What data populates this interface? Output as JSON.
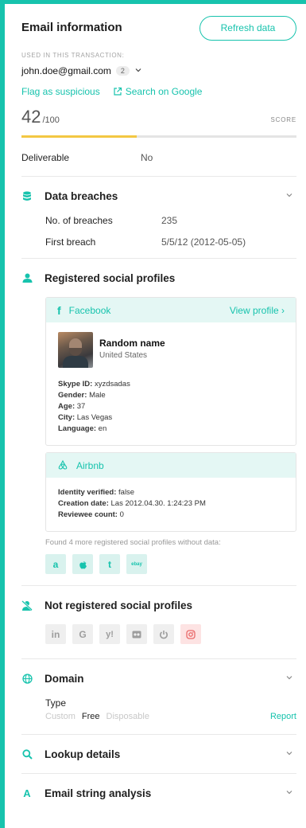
{
  "header": {
    "title": "Email information",
    "refresh_label": "Refresh data"
  },
  "email": {
    "used_label": "USED IN THIS TRANSACTION:",
    "address": "john.doe@gmail.com",
    "count": "2",
    "flag_link": "Flag as suspicious",
    "search_link": "Search on Google"
  },
  "score": {
    "value": "42",
    "total": "/100",
    "label": "SCORE",
    "fraction": 0.42,
    "bar_color": "#f3c743"
  },
  "deliverable": {
    "label": "Deliverable",
    "value": "No"
  },
  "breaches": {
    "title": "Data breaches",
    "rows": [
      {
        "label": "No. of breaches",
        "value": "235"
      },
      {
        "label": "First breach",
        "value": "5/5/12 (2012-05-05)"
      }
    ]
  },
  "social": {
    "title": "Registered social profiles",
    "facebook": {
      "name": "Facebook",
      "view": "View profile",
      "profile_name": "Random name",
      "profile_location": "United States",
      "fields": [
        {
          "k": "Skype ID:",
          "v": "xyzdsadas"
        },
        {
          "k": "Gender:",
          "v": "Male"
        },
        {
          "k": "Age:",
          "v": "37"
        },
        {
          "k": "City:",
          "v": "Las Vegas"
        },
        {
          "k": "Language:",
          "v": "en"
        }
      ]
    },
    "airbnb": {
      "name": "Airbnb",
      "fields": [
        {
          "k": "Identity verified:",
          "v": "false"
        },
        {
          "k": "Creation date:",
          "v": "Las 2012.04.30. 1:24:23 PM"
        },
        {
          "k": "Reviewee count:",
          "v": "0"
        }
      ]
    },
    "more_text": "Found 4 more registered social profiles without data:",
    "more_icons": [
      "amazon-icon",
      "apple-icon",
      "tumblr-icon",
      "ebay-icon"
    ]
  },
  "not_registered": {
    "title": "Not registered social profiles",
    "icons": [
      "linkedin-icon",
      "google-icon",
      "yahoo-icon",
      "flickr-icon",
      "power-icon",
      "instagram-icon"
    ]
  },
  "domain": {
    "title": "Domain",
    "type_label": "Type",
    "options": [
      "Custom",
      "Free",
      "Disposable"
    ],
    "selected": "Free",
    "report": "Report"
  },
  "lookup": {
    "title": "Lookup details"
  },
  "string_analysis": {
    "title": "Email string analysis"
  },
  "colors": {
    "accent": "#17c3ad",
    "score_bar": "#f3c743"
  }
}
